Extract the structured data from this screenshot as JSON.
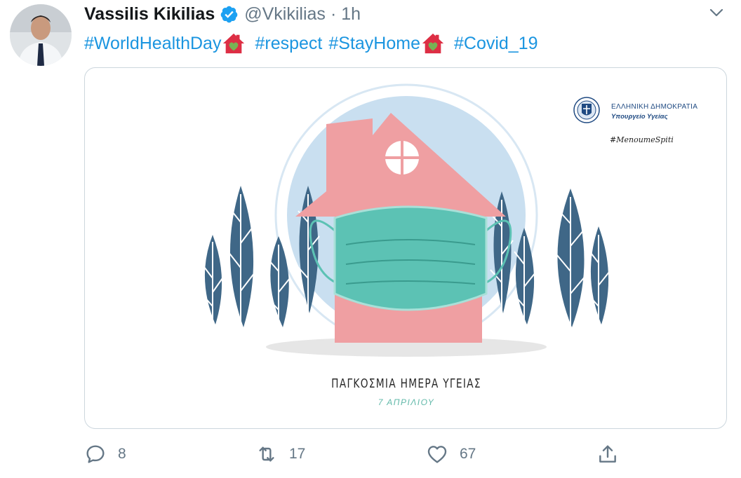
{
  "tweet": {
    "author_name": "Vassilis Kikilias",
    "author_handle": "@Vkikilias",
    "separator": "·",
    "time": "1h",
    "hashtags": [
      "#WorldHealthDay",
      "#respect",
      "#StayHome",
      "#Covid_19"
    ],
    "colors": {
      "link": "#1b95e0",
      "verified": "#1da1f2",
      "muted": "#657786"
    }
  },
  "media": {
    "gov_line1": "ΕΛΛΗΝΙΚΗ ΔΗΜΟΚΡΑΤΙΑ",
    "gov_line2": "Υπουργείο Υγείας",
    "campaign_tag": "#MenoumeSpiti",
    "caption_title": "ΠΑΓΚΟΣΜΙΑ ΗΜΕΡΑ ΥΓΕΙΑΣ",
    "caption_date": "7 ΑΠΡΙΛΙΟΥ"
  },
  "actions": {
    "reply_icon": "reply-icon",
    "reply_count": "8",
    "retweet_icon": "retweet-icon",
    "retweet_count": "17",
    "like_icon": "heart-icon",
    "like_count": "67",
    "share_icon": "share-icon"
  }
}
